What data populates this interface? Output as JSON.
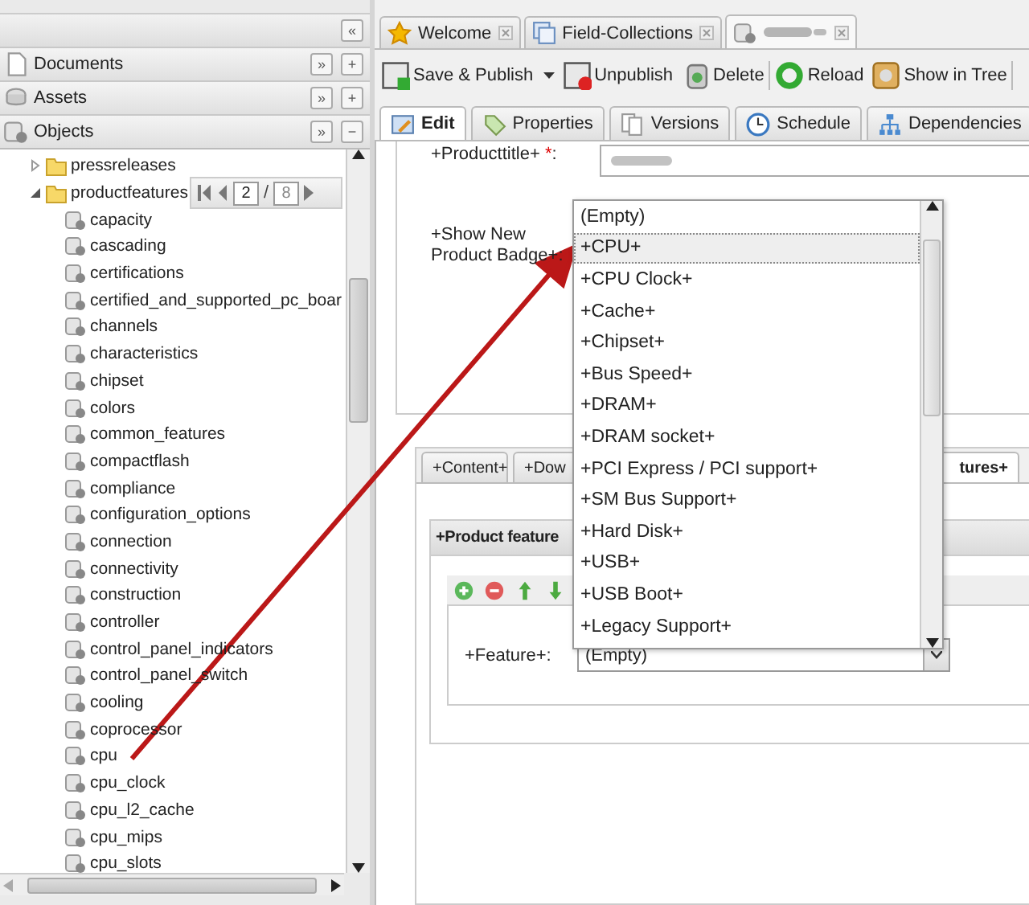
{
  "left_panel": {
    "collapse_button": "«",
    "accordions": [
      {
        "label": "Documents",
        "expand_button": "»",
        "action_button": "+"
      },
      {
        "label": "Assets",
        "expand_button": "»",
        "action_button": "+"
      },
      {
        "label": "Objects",
        "expand_button": "»",
        "action_button": "−"
      }
    ],
    "tree": [
      {
        "label": "pressreleases",
        "kind": "folder",
        "expanded": false
      },
      {
        "label": "productfeatures",
        "kind": "folder",
        "expanded": true,
        "children": [
          {
            "label": "capacity",
            "kind": "object"
          },
          {
            "label": "cascading",
            "kind": "object"
          },
          {
            "label": "certifications",
            "kind": "object"
          },
          {
            "label": "certified_and_supported_pc_boar",
            "kind": "object"
          },
          {
            "label": "channels",
            "kind": "object"
          },
          {
            "label": "characteristics",
            "kind": "object"
          },
          {
            "label": "chipset",
            "kind": "object"
          },
          {
            "label": "colors",
            "kind": "object"
          },
          {
            "label": "common_features",
            "kind": "object"
          },
          {
            "label": "compactflash",
            "kind": "object"
          },
          {
            "label": "compliance",
            "kind": "object"
          },
          {
            "label": "configuration_options",
            "kind": "object"
          },
          {
            "label": "connection",
            "kind": "object"
          },
          {
            "label": "connectivity",
            "kind": "object"
          },
          {
            "label": "construction",
            "kind": "object"
          },
          {
            "label": "controller",
            "kind": "object"
          },
          {
            "label": "control_panel_indicators",
            "kind": "object"
          },
          {
            "label": "control_panel_switch",
            "kind": "object"
          },
          {
            "label": "cooling",
            "kind": "object"
          },
          {
            "label": "coprocessor",
            "kind": "object"
          },
          {
            "label": "cpu",
            "kind": "object"
          },
          {
            "label": "cpu_clock",
            "kind": "object"
          },
          {
            "label": "cpu_l2_cache",
            "kind": "object"
          },
          {
            "label": "cpu_mips",
            "kind": "object"
          },
          {
            "label": "cpu_slots",
            "kind": "object"
          }
        ]
      }
    ],
    "pager": {
      "page": "2",
      "separator": "/",
      "total": "8"
    }
  },
  "tabs": [
    {
      "label": "Welcome",
      "selected": false
    },
    {
      "label": "Field-Collections",
      "selected": false
    },
    {
      "selected": true
    }
  ],
  "toolbar": [
    {
      "kind": "button",
      "label": "Save & Publish",
      "menu": true
    },
    {
      "kind": "button",
      "label": "Unpublish",
      "menu": false
    },
    {
      "kind": "button",
      "label": "Delete",
      "menu": false
    },
    {
      "kind": "separator"
    },
    {
      "kind": "button",
      "label": "Reload",
      "menu": false
    },
    {
      "kind": "button",
      "label": "Show in Tree",
      "menu": false
    },
    {
      "kind": "separator"
    }
  ],
  "subtabs": [
    {
      "label": "Edit",
      "selected": true
    },
    {
      "label": "Properties",
      "selected": false
    },
    {
      "label": "Versions",
      "selected": false
    },
    {
      "label": "Schedule",
      "selected": false
    },
    {
      "label": "Dependencies",
      "selected": false
    }
  ],
  "form": {
    "title_field": {
      "label": "+Producttitle+ ",
      "required_mark": "*",
      "suffix": ":"
    },
    "badge_field": {
      "label": "+Show New Product Badge+:"
    },
    "lower_tabs": [
      {
        "label": "+Content+",
        "selected": false
      },
      {
        "label": "+Dow",
        "selected": false
      },
      {
        "label": "tures+",
        "selected": true
      }
    ],
    "feature_panel": {
      "title": "+Product feature",
      "field": {
        "label": "+Feature+:",
        "value": "(Empty)"
      }
    }
  },
  "dropdown": {
    "options": [
      {
        "label": "(Empty)",
        "selected": false
      },
      {
        "label": "+CPU+",
        "selected": true
      },
      {
        "label": "+CPU Clock+",
        "selected": false
      },
      {
        "label": "+Cache+",
        "selected": false
      },
      {
        "label": "+Chipset+",
        "selected": false
      },
      {
        "label": "+Bus Speed+",
        "selected": false
      },
      {
        "label": "+DRAM+",
        "selected": false
      },
      {
        "label": "+DRAM socket+",
        "selected": false
      },
      {
        "label": "+PCI Express / PCI support+",
        "selected": false
      },
      {
        "label": "+SM Bus Support+",
        "selected": false
      },
      {
        "label": "+Hard Disk+",
        "selected": false
      },
      {
        "label": "+USB+",
        "selected": false
      },
      {
        "label": "+USB Boot+",
        "selected": false
      },
      {
        "label": "+Legacy Support+",
        "selected": false
      }
    ]
  }
}
